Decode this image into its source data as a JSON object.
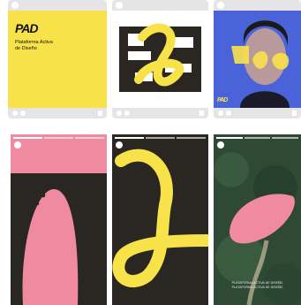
{
  "brand": {
    "logo_text": "PAD",
    "name_line1": "Plataforma Activa",
    "name_line2": "de Diseño"
  },
  "portrait_logo_small": "PAD",
  "forest_caption_line1": "PLATAFORMA ACTIVA DE DISEÑO",
  "forest_caption_line2": "PLATAFORMA ACTIVA DE DISEÑO",
  "colors": {
    "yellow": "#f8e24a",
    "pink": "#f08aa0",
    "dark": "#2a2622",
    "frame": "#e5e5e5",
    "blue": "#4a63d8",
    "forest": "#2e4a35"
  },
  "icons": [
    "heart-icon",
    "comment-icon",
    "bookmark-icon"
  ]
}
